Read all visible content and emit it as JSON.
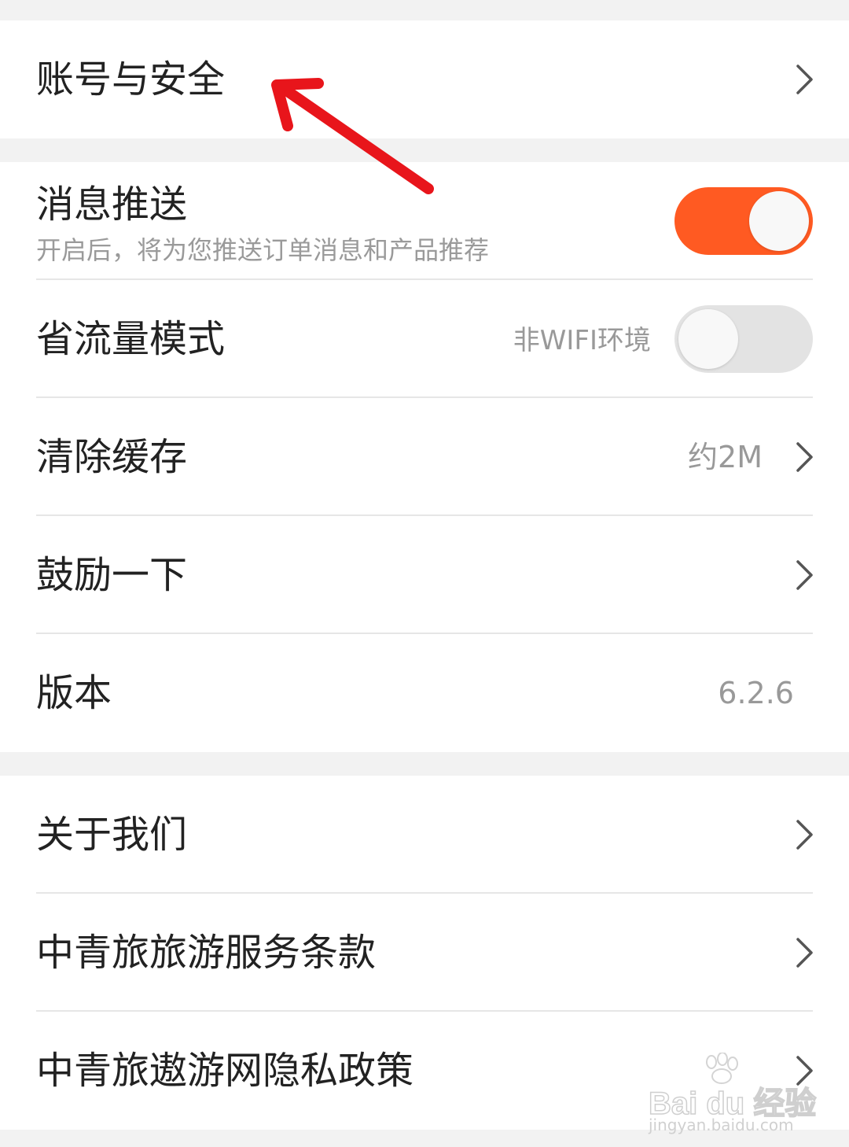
{
  "settings": {
    "group1": {
      "account": {
        "label": "账号与安全"
      }
    },
    "group2": {
      "push": {
        "label": "消息推送",
        "description": "开启后，将为您推送订单消息和产品推荐",
        "enabled": true
      },
      "data_saver": {
        "label": "省流量模式",
        "hint": "非WIFI环境",
        "enabled": false
      },
      "cache": {
        "label": "清除缓存",
        "value": "约2M"
      },
      "encourage": {
        "label": "鼓励一下"
      },
      "version": {
        "label": "版本",
        "value": "6.2.6"
      }
    },
    "group3": {
      "about": {
        "label": "关于我们"
      },
      "terms": {
        "label": "中青旅旅游服务条款"
      },
      "privacy": {
        "label": "中青旅遨游网隐私政策"
      }
    }
  },
  "watermark": {
    "brand": "Bai du 经验",
    "url": "jingyan.baidu.com"
  },
  "colors": {
    "accent": "#ff5a22",
    "annotation_arrow": "#e8151b",
    "background": "#f2f2f2"
  },
  "icons": {
    "row_chevron": "chevron-right-icon",
    "annotation": "red-arrow-annotation"
  }
}
